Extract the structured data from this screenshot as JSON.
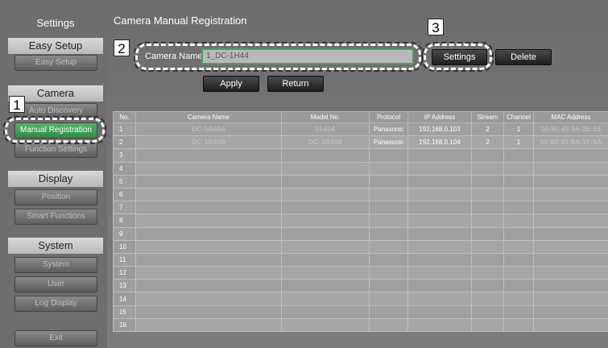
{
  "sidebar": {
    "title": "Settings",
    "sections": {
      "easy_setup": "Easy Setup",
      "camera": "Camera",
      "display": "Display",
      "system": "System"
    },
    "buttons": {
      "easy_setup": "Easy Setup",
      "auto_discovery": "Auto Discovery",
      "manual_registration": "Manual Registration",
      "function_settings": "Function Settings",
      "position": "Position",
      "smart_functions": "Smart Functions",
      "system": "System",
      "user": "User",
      "log_display": "Log Display",
      "exit": "Exit"
    }
  },
  "main": {
    "title": "Camera Manual Registration",
    "camera_name_label": "Camera Name",
    "camera_name_value": "1_DC-1H44",
    "buttons": {
      "settings": "Settings",
      "delete": "Delete",
      "apply": "Apply",
      "return": "Return"
    }
  },
  "callouts": [
    "1",
    "2",
    "3"
  ],
  "table": {
    "headers": [
      "No.",
      "Camera Name",
      "Model No.",
      "Protocol",
      "IP Address",
      "Stream",
      "Channel",
      "MAC Address"
    ],
    "rows": [
      [
        "1",
        "DC-1R404",
        "1F404",
        "Panasonic",
        "192.168.0.103",
        "2",
        "1",
        "00:80:45:9A:2E:33"
      ],
      [
        "2",
        "DC-1R408",
        "DC-1R408",
        "Panasonic",
        "192.168.0.104",
        "2",
        "1",
        "00:80:45:BA:1F:9A"
      ],
      [
        "3",
        "",
        "",
        "",
        "",
        "",
        "",
        ""
      ],
      [
        "4",
        "",
        "",
        "",
        "",
        "",
        "",
        ""
      ],
      [
        "5",
        "",
        "",
        "",
        "",
        "",
        "",
        ""
      ],
      [
        "6",
        "",
        "",
        "",
        "",
        "",
        "",
        ""
      ],
      [
        "7",
        "",
        "",
        "",
        "",
        "",
        "",
        ""
      ],
      [
        "8",
        "",
        "",
        "",
        "",
        "",
        "",
        ""
      ],
      [
        "9",
        "",
        "",
        "",
        "",
        "",
        "",
        ""
      ],
      [
        "10",
        "",
        "",
        "",
        "",
        "",
        "",
        ""
      ],
      [
        "11",
        "",
        "",
        "",
        "",
        "",
        "",
        ""
      ],
      [
        "12",
        "",
        "",
        "",
        "",
        "",
        "",
        ""
      ],
      [
        "13",
        "",
        "",
        "",
        "",
        "",
        "",
        ""
      ],
      [
        "14",
        "",
        "",
        "",
        "",
        "",
        "",
        ""
      ],
      [
        "15",
        "",
        "",
        "",
        "",
        "",
        "",
        ""
      ],
      [
        "16",
        "",
        "",
        "",
        "",
        "",
        "",
        ""
      ]
    ]
  },
  "colors": {
    "sidebar_bg": "#6e6e6e",
    "main_bg": "#757575",
    "accent_green": "#3a9e54",
    "button_dark": "#2a2a2a"
  }
}
